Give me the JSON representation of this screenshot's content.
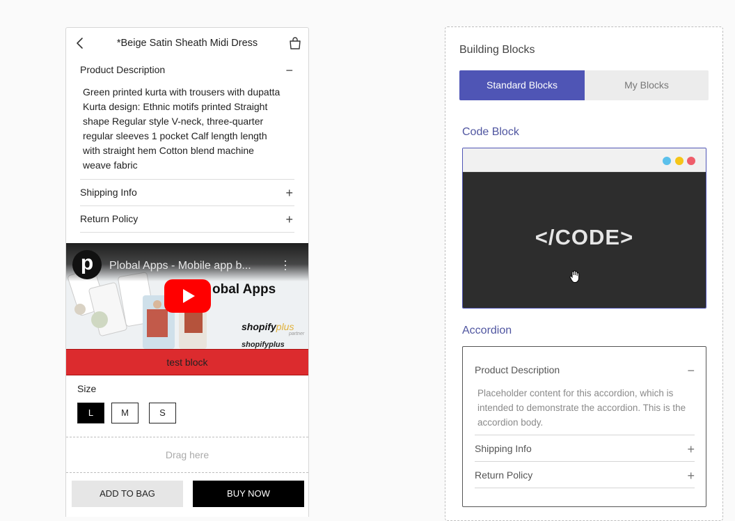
{
  "preview": {
    "title": "*Beige Satin Sheath Midi Dress",
    "accordion": [
      {
        "label": "Product Description",
        "sign": "−"
      },
      {
        "label": "Shipping Info",
        "sign": "+"
      },
      {
        "label": "Return Policy",
        "sign": "+"
      }
    ],
    "description": "Green printed kurta with trousers with dupatta Kurta design: Ethnic motifs printed Straight shape Regular style V-neck, three-quarter regular sleeves 1 pocket Calf length length with straight hem Cotton blend machine weave fabric",
    "video": {
      "avatar": "p",
      "title": "Plobal Apps - Mobile app b...",
      "brand": "obal Apps",
      "shopify": "shopify",
      "plus": "plus",
      "partner": "partner",
      "shopify_under": "shopifyplus"
    },
    "test_block": "test block",
    "size_label": "Size",
    "sizes": [
      "L",
      "M",
      "S"
    ],
    "selected_size": "L",
    "drag_hint": "Drag here",
    "add_to_bag": "ADD TO BAG",
    "buy_now": "BUY NOW"
  },
  "panel": {
    "title": "Building Blocks",
    "tabs": {
      "standard": "Standard Blocks",
      "mine": "My Blocks",
      "active": "standard"
    },
    "code_block": {
      "title": "Code Block",
      "placeholder": "</CODE>",
      "dot_colors": [
        "#5bc0eb",
        "#f5c518",
        "#ef5d6a"
      ]
    },
    "accordion_block": {
      "title": "Accordion",
      "items": [
        {
          "label": "Product Description",
          "sign": "−"
        },
        {
          "label": "Shipping Info",
          "sign": "+"
        },
        {
          "label": "Return Policy",
          "sign": "+"
        }
      ],
      "body": "Placeholder content for this accordion, which is intended to demonstrate the accordion. This is the accordion body."
    }
  },
  "colors": {
    "accent": "#4f55b5",
    "test_block": "#dc2b2e",
    "youtube_red": "#ff0000"
  }
}
